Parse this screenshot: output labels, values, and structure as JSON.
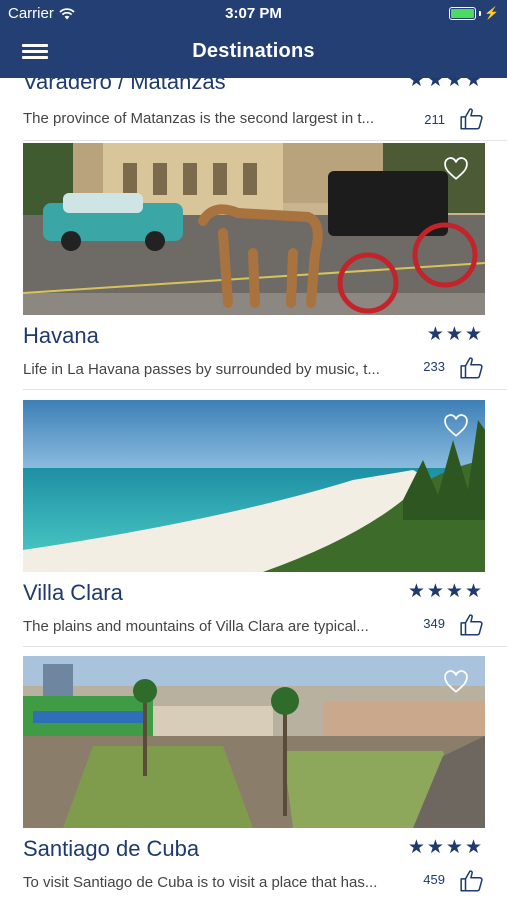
{
  "status_bar": {
    "carrier": "Carrier",
    "time": "3:07 PM"
  },
  "header": {
    "title": "Destinations"
  },
  "destinations": [
    {
      "name": "Varadero / Matanzas",
      "rating": "★★★★",
      "description": "The province of Matanzas is the second largest in t...",
      "likes": "211"
    },
    {
      "name": "Havana",
      "rating": "★★★",
      "description": "Life in La Havana passes by surrounded by music, t...",
      "likes": "233"
    },
    {
      "name": "Villa Clara",
      "rating": "★★★★",
      "description": "The plains and mountains of Villa Clara are typical...",
      "likes": "349"
    },
    {
      "name": "Santiago de Cuba",
      "rating": "★★★★",
      "description": "To visit Santiago de Cuba is to visit a place that has...",
      "likes": "459"
    }
  ],
  "icons": {
    "menu": "hamburger-menu-icon",
    "favorite": "heart-outline-icon",
    "like": "thumbs-up-icon",
    "wifi": "wifi-icon",
    "battery": "battery-charging-icon"
  },
  "colors": {
    "header": "#243f73",
    "accent": "#1e3a6e",
    "battery": "#4cd964"
  }
}
